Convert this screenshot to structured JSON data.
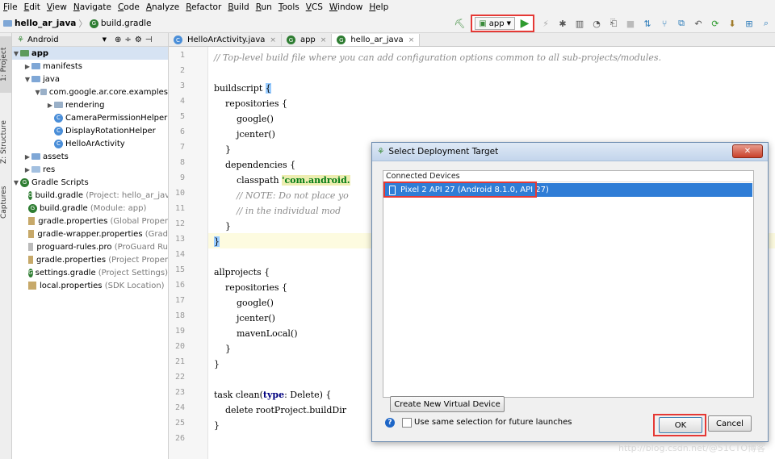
{
  "menu": [
    "File",
    "Edit",
    "View",
    "Navigate",
    "Code",
    "Analyze",
    "Refactor",
    "Build",
    "Run",
    "Tools",
    "VCS",
    "Window",
    "Help"
  ],
  "breadcrumb": {
    "project": "hello_ar_java",
    "file": "build.gradle"
  },
  "toolbar": {
    "run_config": "app",
    "highlight_color": "#e53935"
  },
  "side_tabs": {
    "project": "1: Project",
    "structure": "Z: Structure",
    "captures": "Captures"
  },
  "project_panel": {
    "view_mode": "Android",
    "tree": [
      {
        "label": "app",
        "extra": ""
      },
      {
        "label": "manifests",
        "extra": ""
      },
      {
        "label": "java",
        "extra": ""
      },
      {
        "label": "com.google.ar.core.examples",
        "extra": ""
      },
      {
        "label": "rendering",
        "extra": ""
      },
      {
        "label": "CameraPermissionHelper",
        "extra": ""
      },
      {
        "label": "DisplayRotationHelper",
        "extra": ""
      },
      {
        "label": "HelloArActivity",
        "extra": ""
      },
      {
        "label": "assets",
        "extra": ""
      },
      {
        "label": "res",
        "extra": ""
      },
      {
        "label": "Gradle Scripts",
        "extra": ""
      },
      {
        "label": "build.gradle",
        "extra": "(Project: hello_ar_jav"
      },
      {
        "label": "build.gradle",
        "extra": "(Module: app)"
      },
      {
        "label": "gradle.properties",
        "extra": "(Global Proper"
      },
      {
        "label": "gradle-wrapper.properties",
        "extra": "(Grad"
      },
      {
        "label": "proguard-rules.pro",
        "extra": "(ProGuard Ru"
      },
      {
        "label": "gradle.properties",
        "extra": "(Project Proper"
      },
      {
        "label": "settings.gradle",
        "extra": "(Project Settings)"
      },
      {
        "label": "local.properties",
        "extra": "(SDK Location)"
      }
    ]
  },
  "editor_tabs": [
    {
      "label": "HelloArActivity.java"
    },
    {
      "label": "app"
    },
    {
      "label": "hello_ar_java"
    }
  ],
  "code": {
    "line_numbers": [
      "1",
      "2",
      "3",
      "4",
      "5",
      "6",
      "7",
      "8",
      "9",
      "10",
      "11",
      "12",
      "13",
      "14",
      "15",
      "16",
      "17",
      "18",
      "19",
      "20",
      "21",
      "22",
      "23",
      "24",
      "25",
      "26"
    ],
    "l1": "// Top-level build file where you can add configuration options common to all sub-projects/modules.",
    "l3a": "buildscript ",
    "l3b": "{",
    "l4": "    repositories {",
    "l5": "        google()",
    "l6": "        jcenter()",
    "l7": "    }",
    "l8": "    dependencies {",
    "l9a": "        classpath ",
    "l9b": "'com.android.",
    "l10": "        // NOTE: Do not place yo",
    "l11": "        // in the individual mod",
    "l12": "    }",
    "l13": "}",
    "l15": "allprojects {",
    "l16": "    repositories {",
    "l17": "        google()",
    "l18": "        jcenter()",
    "l19": "        mavenLocal()",
    "l20": "    }",
    "l21": "}",
    "l23a": "task clean(",
    "l23b": "type",
    "l23c": ": Delete) {",
    "l24": "    delete rootProject.buildDir",
    "l25": "}"
  },
  "dialog": {
    "title": "Select Deployment Target",
    "close": "✕",
    "section_label": "Connected Devices",
    "device": "Pixel 2 API 27 (Android 8.1.0, API 27)",
    "create_button": "Create New Virtual Device",
    "help": "?",
    "checkbox_label": "Use same selection for future launches",
    "ok": "OK",
    "cancel": "Cancel"
  },
  "watermark": "http://blog.csdn.net/@51CTO博客"
}
